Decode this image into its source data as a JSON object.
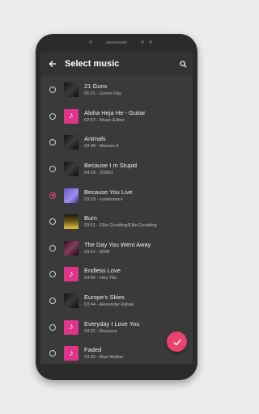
{
  "appbar": {
    "title": "Select music"
  },
  "songs": [
    {
      "title": "21 Guns",
      "duration": "05:21",
      "artist": "Green Day",
      "thumb": "art-dark",
      "selected": false
    },
    {
      "title": "Aloha Heja He - Guitar",
      "duration": "02:57",
      "artist": "Music Editor",
      "thumb": "note",
      "selected": false
    },
    {
      "title": "Animals",
      "duration": "03:48",
      "artist": "Maroon 5",
      "thumb": "art-dark",
      "selected": false
    },
    {
      "title": "Because I m Stupid",
      "duration": "04:19",
      "artist": "SS501",
      "thumb": "art-dark",
      "selected": false
    },
    {
      "title": "Because You Live",
      "duration": "03:19",
      "artist": "<unknown>",
      "thumb": "art-purple",
      "selected": true
    },
    {
      "title": "Burn",
      "duration": "03:51",
      "artist": "Ellie Goulding/Ellie Goulding",
      "thumb": "art-yellow",
      "selected": false
    },
    {
      "title": "The Day You Went Away",
      "duration": "03:41",
      "artist": "M2M",
      "thumb": "art-rose",
      "selected": false
    },
    {
      "title": "Endless Love",
      "duration": "04:56",
      "artist": "Hòa Tấu",
      "thumb": "note",
      "selected": false
    },
    {
      "title": "Europe's Skies",
      "duration": "03:44",
      "artist": "Alexander Rybak",
      "thumb": "art-dark",
      "selected": false
    },
    {
      "title": "Everyday I Love You",
      "duration": "03:31",
      "artist": "Boyzone",
      "thumb": "note",
      "selected": false
    },
    {
      "title": "Faded",
      "duration": "03:32",
      "artist": "Alan Walker",
      "thumb": "note",
      "selected": false
    }
  ],
  "colors": {
    "accent": "#e8436f",
    "background": "#3a3a3a",
    "note_thumb": "#e0338a"
  },
  "icons": {
    "back": "arrow-left-icon",
    "search": "search-icon",
    "note": "music-note-icon",
    "confirm": "check-icon"
  }
}
